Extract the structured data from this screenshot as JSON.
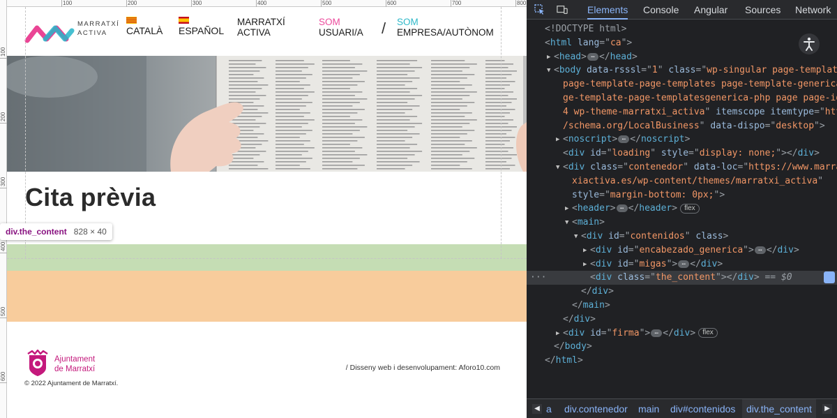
{
  "page": {
    "ruler_top_labels": [
      "100",
      "200",
      "300",
      "400",
      "500",
      "600",
      "700",
      "800"
    ],
    "ruler_left_labels": [
      "100",
      "200",
      "300",
      "400",
      "500",
      "600"
    ],
    "header": {
      "logo_line1": "MARRATXÍ",
      "logo_line2": "ACTIVA",
      "lang_ca": "CATALÀ",
      "lang_es": "ESPAÑOL",
      "nav_marratxi": [
        "MARRATXÍ",
        "ACTIVA"
      ],
      "nav_usuari": [
        "SOM",
        "USUARI/A"
      ],
      "nav_empresa": [
        "SOM",
        "EMPRESA/AUTÒNOM"
      ],
      "nav_separator": "/"
    },
    "title": "Cita prèvia",
    "inspect_tooltip": {
      "name": "div.the_content",
      "size": "828 × 40"
    },
    "footer": {
      "org_line1": "Ajuntament",
      "org_line2": "de Marratxí",
      "credit": "/ Disseny web i desenvolupament: Aforo10.com",
      "copyright": "© 2022 Ajuntament de Marratxí."
    },
    "colors": {
      "brand_pink": "#e8318a",
      "brand_teal": "#27b5c9",
      "nav_pink": "#ec4a9c",
      "nav_teal": "#2eb8c8",
      "content_box": "#c5ddb4",
      "margin_box": "#f8cc9c",
      "footer_magenta": "#c4197c"
    },
    "icons": [
      "marratxi-activa-logo",
      "catalan-flag-icon",
      "spanish-flag-icon",
      "ajuntament-crest-icon"
    ]
  },
  "devtools": {
    "tabs": [
      "Elements",
      "Console",
      "Angular",
      "Sources",
      "Network"
    ],
    "active_tab": "Elements",
    "dom_lines": [
      {
        "indent": 0,
        "tri": "",
        "html": [
          [
            "punc",
            "<!DOCTYPE html>"
          ]
        ]
      },
      {
        "indent": 0,
        "tri": "",
        "html": [
          [
            "punc",
            "<"
          ],
          [
            "tag",
            "html"
          ],
          [
            "attr",
            " lang"
          ],
          [
            "punc",
            "=\""
          ],
          [
            "val",
            "ca"
          ],
          [
            "punc",
            "\">"
          ]
        ]
      },
      {
        "indent": 1,
        "tri": "▶",
        "html": [
          [
            "punc",
            "<"
          ],
          [
            "tag",
            "head"
          ],
          [
            "punc",
            ">"
          ],
          [
            "ell",
            "…"
          ],
          [
            "punc",
            "</"
          ],
          [
            "tag",
            "head"
          ],
          [
            "punc",
            ">"
          ]
        ]
      },
      {
        "indent": 1,
        "tri": "▼",
        "html": [
          [
            "punc",
            "<"
          ],
          [
            "tag",
            "body"
          ],
          [
            "attr",
            " data-rsssl"
          ],
          [
            "punc",
            "=\""
          ],
          [
            "val",
            "1"
          ],
          [
            "punc",
            "\""
          ],
          [
            "attr",
            " class"
          ],
          [
            "punc",
            "=\""
          ],
          [
            "val",
            "wp-singular page-template"
          ]
        ]
      },
      {
        "indent": 2,
        "tri": "",
        "html": [
          [
            "val",
            "page-template-page-templates page-template-generica pa"
          ]
        ]
      },
      {
        "indent": 2,
        "tri": "",
        "html": [
          [
            "val",
            "ge-template-page-templatesgenerica-php page page-id-77"
          ]
        ]
      },
      {
        "indent": 2,
        "tri": "",
        "html": [
          [
            "val",
            "4 wp-theme-marratxi_activa"
          ],
          [
            "punc",
            "\""
          ],
          [
            "attr",
            " itemscope"
          ],
          [
            "attr",
            " itemtype"
          ],
          [
            "punc",
            "=\""
          ],
          [
            "val",
            "http:/"
          ]
        ]
      },
      {
        "indent": 2,
        "tri": "",
        "html": [
          [
            "val",
            "/schema.org/LocalBusiness"
          ],
          [
            "punc",
            "\""
          ],
          [
            "attr",
            " data-dispo"
          ],
          [
            "punc",
            "=\""
          ],
          [
            "val",
            "desktop"
          ],
          [
            "punc",
            "\">"
          ]
        ]
      },
      {
        "indent": 2,
        "tri": "▶",
        "html": [
          [
            "punc",
            "<"
          ],
          [
            "tag",
            "noscript"
          ],
          [
            "punc",
            ">"
          ],
          [
            "ell",
            "…"
          ],
          [
            "punc",
            "</"
          ],
          [
            "tag",
            "noscript"
          ],
          [
            "punc",
            ">"
          ]
        ]
      },
      {
        "indent": 2,
        "tri": "",
        "html": [
          [
            "punc",
            "<"
          ],
          [
            "tag",
            "div"
          ],
          [
            "attr",
            " id"
          ],
          [
            "punc",
            "=\""
          ],
          [
            "val",
            "loading"
          ],
          [
            "punc",
            "\""
          ],
          [
            "attr",
            " style"
          ],
          [
            "punc",
            "=\""
          ],
          [
            "val",
            "display: none;"
          ],
          [
            "punc",
            "\"></"
          ],
          [
            "tag",
            "div"
          ],
          [
            "punc",
            ">"
          ]
        ]
      },
      {
        "indent": 2,
        "tri": "▼",
        "html": [
          [
            "punc",
            "<"
          ],
          [
            "tag",
            "div"
          ],
          [
            "attr",
            " class"
          ],
          [
            "punc",
            "=\""
          ],
          [
            "val",
            "contenedor"
          ],
          [
            "punc",
            "\""
          ],
          [
            "attr",
            " data-loc"
          ],
          [
            "punc",
            "=\""
          ],
          [
            "val",
            "https://www.marrat"
          ]
        ]
      },
      {
        "indent": 3,
        "tri": "",
        "html": [
          [
            "val",
            "xiactiva.es/wp-content/themes/marratxi_activa"
          ],
          [
            "punc",
            "\""
          ]
        ]
      },
      {
        "indent": 3,
        "tri": "",
        "html": [
          [
            "attr",
            "style"
          ],
          [
            "punc",
            "=\""
          ],
          [
            "val",
            "margin-bottom: 0px;"
          ],
          [
            "punc",
            "\">"
          ]
        ]
      },
      {
        "indent": 3,
        "tri": "▶",
        "html": [
          [
            "punc",
            "<"
          ],
          [
            "tag",
            "header"
          ],
          [
            "punc",
            ">"
          ],
          [
            "ell",
            "…"
          ],
          [
            "punc",
            "</"
          ],
          [
            "tag",
            "header"
          ],
          [
            "punc",
            ">"
          ],
          [
            "badge",
            "flex"
          ]
        ]
      },
      {
        "indent": 3,
        "tri": "▼",
        "html": [
          [
            "punc",
            "<"
          ],
          [
            "tag",
            "main"
          ],
          [
            "punc",
            ">"
          ]
        ]
      },
      {
        "indent": 4,
        "tri": "▼",
        "html": [
          [
            "punc",
            "<"
          ],
          [
            "tag",
            "div"
          ],
          [
            "attr",
            " id"
          ],
          [
            "punc",
            "=\""
          ],
          [
            "val",
            "contenidos"
          ],
          [
            "punc",
            "\""
          ],
          [
            "attr",
            " class"
          ],
          [
            "punc",
            ">"
          ]
        ]
      },
      {
        "indent": 5,
        "tri": "▶",
        "html": [
          [
            "punc",
            "<"
          ],
          [
            "tag",
            "div"
          ],
          [
            "attr",
            " id"
          ],
          [
            "punc",
            "=\""
          ],
          [
            "val",
            "encabezado_generica"
          ],
          [
            "punc",
            "\">"
          ],
          [
            "ell",
            "…"
          ],
          [
            "punc",
            "</"
          ],
          [
            "tag",
            "div"
          ],
          [
            "punc",
            ">"
          ]
        ]
      },
      {
        "indent": 5,
        "tri": "▶",
        "html": [
          [
            "punc",
            "<"
          ],
          [
            "tag",
            "div"
          ],
          [
            "attr",
            " id"
          ],
          [
            "punc",
            "=\""
          ],
          [
            "val",
            "migas"
          ],
          [
            "punc",
            "\">"
          ],
          [
            "ell",
            "…"
          ],
          [
            "punc",
            "</"
          ],
          [
            "tag",
            "div"
          ],
          [
            "punc",
            ">"
          ]
        ]
      },
      {
        "indent": 5,
        "tri": "",
        "sel": true,
        "html": [
          [
            "punc",
            "<"
          ],
          [
            "tag",
            "div"
          ],
          [
            "attr",
            " class"
          ],
          [
            "punc",
            "=\""
          ],
          [
            "val",
            "the_content"
          ],
          [
            "punc",
            "\"></"
          ],
          [
            "tag",
            "div"
          ],
          [
            "punc",
            ">"
          ],
          [
            "dim",
            " == $0"
          ]
        ]
      },
      {
        "indent": 4,
        "tri": "",
        "html": [
          [
            "punc",
            "</"
          ],
          [
            "tag",
            "div"
          ],
          [
            "punc",
            ">"
          ]
        ]
      },
      {
        "indent": 3,
        "tri": "",
        "html": [
          [
            "punc",
            "</"
          ],
          [
            "tag",
            "main"
          ],
          [
            "punc",
            ">"
          ]
        ]
      },
      {
        "indent": 2,
        "tri": "",
        "html": [
          [
            "punc",
            "</"
          ],
          [
            "tag",
            "div"
          ],
          [
            "punc",
            ">"
          ]
        ]
      },
      {
        "indent": 2,
        "tri": "▶",
        "html": [
          [
            "punc",
            "<"
          ],
          [
            "tag",
            "div"
          ],
          [
            "attr",
            " id"
          ],
          [
            "punc",
            "=\""
          ],
          [
            "val",
            "firma"
          ],
          [
            "punc",
            "\">"
          ],
          [
            "ell",
            "…"
          ],
          [
            "punc",
            "</"
          ],
          [
            "tag",
            "div"
          ],
          [
            "punc",
            ">"
          ],
          [
            "badge",
            "flex"
          ]
        ]
      },
      {
        "indent": 1,
        "tri": "",
        "html": [
          [
            "punc",
            "</"
          ],
          [
            "tag",
            "body"
          ],
          [
            "punc",
            ">"
          ]
        ]
      },
      {
        "indent": 0,
        "tri": "",
        "html": [
          [
            "punc",
            "</"
          ],
          [
            "tag",
            "html"
          ],
          [
            "punc",
            ">"
          ]
        ]
      }
    ],
    "breadcrumbs": [
      "a",
      "div.contenedor",
      "main",
      "div#contenidos",
      "div.the_content"
    ],
    "active_breadcrumb": "div.the_content",
    "selected_dim": "== $0"
  }
}
